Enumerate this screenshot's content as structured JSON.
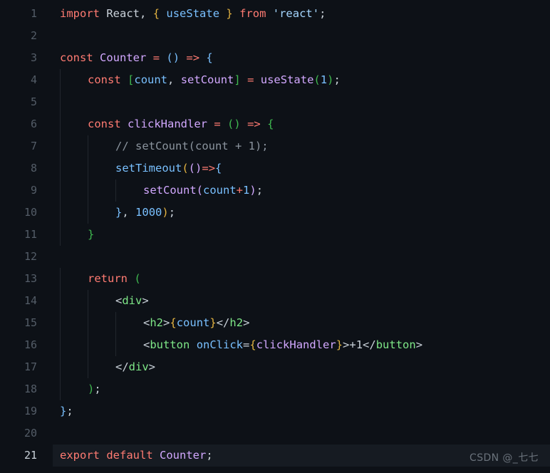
{
  "editor": {
    "theme": "github-dark",
    "background": "#0d1117",
    "active_line_background": "#161b22",
    "gutter_color": "#545d68",
    "active_gutter_color": "#c9d1d9",
    "indent_guide_color": "#21262d",
    "language": "javascript-jsx",
    "total_lines": 21,
    "active_line": 21
  },
  "watermark": {
    "text": "CSDN @_七七"
  },
  "palette": {
    "keyword": "#ff7b72",
    "variable": "#79c0ff",
    "function": "#d2a8ff",
    "string": "#a5d6ff",
    "comment": "#8b949e",
    "tag": "#7ee787",
    "plain": "#c9d1d9",
    "bracket_yellow": "#e3b341",
    "bracket_purple": "#d2a8ff",
    "bracket_blue": "#79c0ff",
    "bracket_green": "#3fb950"
  },
  "code": {
    "lines": [
      {
        "n": "1",
        "indent": 0,
        "active": false,
        "text": "import React, { useState } from 'react';",
        "tokens": [
          {
            "t": "import",
            "c": "kw"
          },
          {
            "t": " ",
            "c": "plain"
          },
          {
            "t": "React",
            "c": "plain"
          },
          {
            "t": ",",
            "c": "punct"
          },
          {
            "t": " ",
            "c": "plain"
          },
          {
            "t": "{",
            "c": "b-yel"
          },
          {
            "t": " ",
            "c": "plain"
          },
          {
            "t": "useState",
            "c": "var"
          },
          {
            "t": " ",
            "c": "plain"
          },
          {
            "t": "}",
            "c": "b-yel"
          },
          {
            "t": " ",
            "c": "plain"
          },
          {
            "t": "from",
            "c": "kw"
          },
          {
            "t": " ",
            "c": "plain"
          },
          {
            "t": "'react'",
            "c": "str"
          },
          {
            "t": ";",
            "c": "punct"
          }
        ]
      },
      {
        "n": "2",
        "indent": 0,
        "active": false,
        "text": "",
        "tokens": []
      },
      {
        "n": "3",
        "indent": 0,
        "active": false,
        "text": "const Counter = () => {",
        "tokens": [
          {
            "t": "const",
            "c": "kw"
          },
          {
            "t": " ",
            "c": "plain"
          },
          {
            "t": "Counter",
            "c": "fn"
          },
          {
            "t": " ",
            "c": "plain"
          },
          {
            "t": "=",
            "c": "op"
          },
          {
            "t": " ",
            "c": "plain"
          },
          {
            "t": "(",
            "c": "b-blu"
          },
          {
            "t": ")",
            "c": "b-blu"
          },
          {
            "t": " ",
            "c": "plain"
          },
          {
            "t": "=>",
            "c": "op"
          },
          {
            "t": " ",
            "c": "plain"
          },
          {
            "t": "{",
            "c": "b-blu"
          }
        ]
      },
      {
        "n": "4",
        "indent": 1,
        "active": false,
        "text": "const [count, setCount] = useState(1);",
        "tokens": [
          {
            "t": "const",
            "c": "kw"
          },
          {
            "t": " ",
            "c": "plain"
          },
          {
            "t": "[",
            "c": "b-grn"
          },
          {
            "t": "count",
            "c": "var"
          },
          {
            "t": ",",
            "c": "punct"
          },
          {
            "t": " ",
            "c": "plain"
          },
          {
            "t": "setCount",
            "c": "fn"
          },
          {
            "t": "]",
            "c": "b-grn"
          },
          {
            "t": " ",
            "c": "plain"
          },
          {
            "t": "=",
            "c": "op"
          },
          {
            "t": " ",
            "c": "plain"
          },
          {
            "t": "useState",
            "c": "fn"
          },
          {
            "t": "(",
            "c": "b-grn"
          },
          {
            "t": "1",
            "c": "num"
          },
          {
            "t": ")",
            "c": "b-grn"
          },
          {
            "t": ";",
            "c": "punct"
          }
        ]
      },
      {
        "n": "5",
        "indent": 1,
        "active": false,
        "text": "",
        "tokens": []
      },
      {
        "n": "6",
        "indent": 1,
        "active": false,
        "text": "const clickHandler = () => {",
        "tokens": [
          {
            "t": "const",
            "c": "kw"
          },
          {
            "t": " ",
            "c": "plain"
          },
          {
            "t": "clickHandler",
            "c": "fn"
          },
          {
            "t": " ",
            "c": "plain"
          },
          {
            "t": "=",
            "c": "op"
          },
          {
            "t": " ",
            "c": "plain"
          },
          {
            "t": "(",
            "c": "b-grn"
          },
          {
            "t": ")",
            "c": "b-grn"
          },
          {
            "t": " ",
            "c": "plain"
          },
          {
            "t": "=>",
            "c": "op"
          },
          {
            "t": " ",
            "c": "plain"
          },
          {
            "t": "{",
            "c": "b-grn"
          }
        ]
      },
      {
        "n": "7",
        "indent": 2,
        "active": false,
        "text": "// setCount(count + 1);",
        "tokens": [
          {
            "t": "// setCount(count + 1);",
            "c": "cmt"
          }
        ]
      },
      {
        "n": "8",
        "indent": 2,
        "active": false,
        "text": "setTimeout(()=>{",
        "tokens": [
          {
            "t": "setTimeout",
            "c": "var"
          },
          {
            "t": "(",
            "c": "b-yel"
          },
          {
            "t": "(",
            "c": "b-pur"
          },
          {
            "t": ")",
            "c": "b-pur"
          },
          {
            "t": "=>",
            "c": "op"
          },
          {
            "t": "{",
            "c": "b-blu"
          }
        ]
      },
      {
        "n": "9",
        "indent": 3,
        "active": false,
        "text": "setCount(count+1);",
        "tokens": [
          {
            "t": "setCount",
            "c": "fn"
          },
          {
            "t": "(",
            "c": "b-pur"
          },
          {
            "t": "count",
            "c": "var"
          },
          {
            "t": "+",
            "c": "op"
          },
          {
            "t": "1",
            "c": "num"
          },
          {
            "t": ")",
            "c": "b-pur"
          },
          {
            "t": ";",
            "c": "punct"
          }
        ]
      },
      {
        "n": "10",
        "indent": 2,
        "active": false,
        "text": "}, 1000);",
        "tokens": [
          {
            "t": "}",
            "c": "b-blu"
          },
          {
            "t": ",",
            "c": "punct"
          },
          {
            "t": " ",
            "c": "plain"
          },
          {
            "t": "1000",
            "c": "num"
          },
          {
            "t": ")",
            "c": "b-yel"
          },
          {
            "t": ";",
            "c": "punct"
          }
        ]
      },
      {
        "n": "11",
        "indent": 1,
        "active": false,
        "text": "}",
        "tokens": [
          {
            "t": "}",
            "c": "b-grn"
          }
        ]
      },
      {
        "n": "12",
        "indent": 0,
        "active": false,
        "text": "",
        "tokens": []
      },
      {
        "n": "13",
        "indent": 1,
        "active": false,
        "text": "return (",
        "tokens": [
          {
            "t": "return",
            "c": "kw"
          },
          {
            "t": " ",
            "c": "plain"
          },
          {
            "t": "(",
            "c": "b-grn"
          }
        ]
      },
      {
        "n": "14",
        "indent": 2,
        "active": false,
        "text": "<div>",
        "tokens": [
          {
            "t": "<",
            "c": "tagb"
          },
          {
            "t": "div",
            "c": "tag"
          },
          {
            "t": ">",
            "c": "tagb"
          }
        ]
      },
      {
        "n": "15",
        "indent": 3,
        "active": false,
        "text": "<h2>{count}</h2>",
        "tokens": [
          {
            "t": "<",
            "c": "tagb"
          },
          {
            "t": "h2",
            "c": "tag"
          },
          {
            "t": ">",
            "c": "tagb"
          },
          {
            "t": "{",
            "c": "b-yel"
          },
          {
            "t": "count",
            "c": "var"
          },
          {
            "t": "}",
            "c": "b-yel"
          },
          {
            "t": "</",
            "c": "tagb"
          },
          {
            "t": "h2",
            "c": "tag"
          },
          {
            "t": ">",
            "c": "tagb"
          }
        ]
      },
      {
        "n": "16",
        "indent": 3,
        "active": false,
        "text": "<button onClick={clickHandler}>+1</button>",
        "tokens": [
          {
            "t": "<",
            "c": "tagb"
          },
          {
            "t": "button",
            "c": "tag"
          },
          {
            "t": " ",
            "c": "plain"
          },
          {
            "t": "onClick",
            "c": "attr"
          },
          {
            "t": "=",
            "c": "tagb"
          },
          {
            "t": "{",
            "c": "b-yel"
          },
          {
            "t": "clickHandler",
            "c": "fn"
          },
          {
            "t": "}",
            "c": "b-yel"
          },
          {
            "t": ">",
            "c": "tagb"
          },
          {
            "t": "+1",
            "c": "plain"
          },
          {
            "t": "</",
            "c": "tagb"
          },
          {
            "t": "button",
            "c": "tag"
          },
          {
            "t": ">",
            "c": "tagb"
          }
        ]
      },
      {
        "n": "17",
        "indent": 2,
        "active": false,
        "text": "</div>",
        "tokens": [
          {
            "t": "</",
            "c": "tagb"
          },
          {
            "t": "div",
            "c": "tag"
          },
          {
            "t": ">",
            "c": "tagb"
          }
        ]
      },
      {
        "n": "18",
        "indent": 1,
        "active": false,
        "text": ");",
        "tokens": [
          {
            "t": ")",
            "c": "b-grn"
          },
          {
            "t": ";",
            "c": "punct"
          }
        ]
      },
      {
        "n": "19",
        "indent": 0,
        "active": false,
        "text": "};",
        "tokens": [
          {
            "t": "}",
            "c": "b-blu"
          },
          {
            "t": ";",
            "c": "punct"
          }
        ]
      },
      {
        "n": "20",
        "indent": 0,
        "active": false,
        "text": "",
        "tokens": []
      },
      {
        "n": "21",
        "indent": 0,
        "active": true,
        "text": "export default Counter;",
        "tokens": [
          {
            "t": "export",
            "c": "kw"
          },
          {
            "t": " ",
            "c": "plain"
          },
          {
            "t": "default",
            "c": "kw"
          },
          {
            "t": " ",
            "c": "plain"
          },
          {
            "t": "Counter",
            "c": "fn"
          },
          {
            "t": ";",
            "c": "punct"
          }
        ]
      }
    ]
  }
}
